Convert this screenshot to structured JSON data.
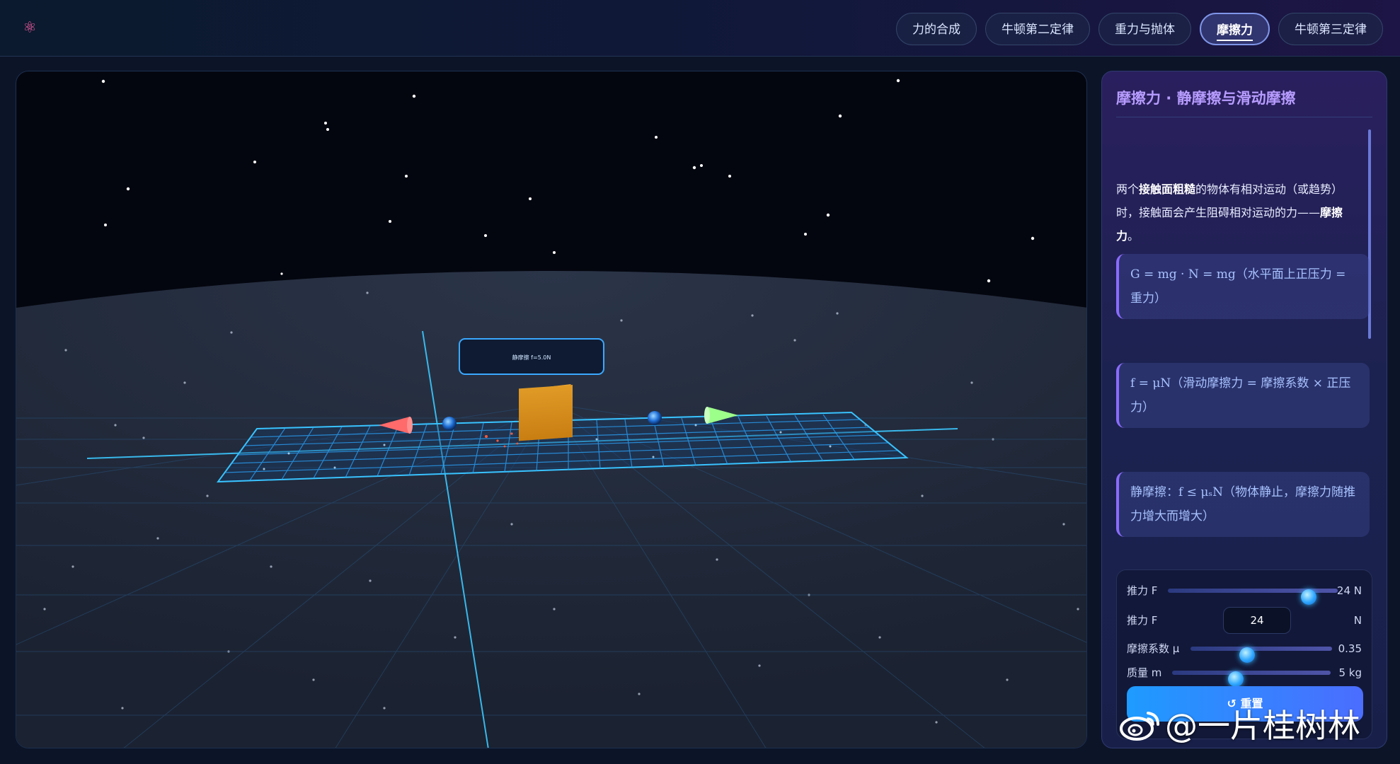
{
  "header": {
    "app_title": "",
    "tabs": [
      {
        "label": "力的合成",
        "active": false
      },
      {
        "label": "牛顿第二定律",
        "active": false
      },
      {
        "label": "重力与抛体",
        "active": false
      },
      {
        "label": "摩擦力",
        "active": true
      },
      {
        "label": "牛顿第三定律",
        "active": false
      }
    ]
  },
  "scene": {
    "label_text": "静摩擦 f=5.0N",
    "box_color": "#d98c1e",
    "push_arrow_color": "#9cff8a",
    "friction_arrow_color": "#ff6a6a",
    "grid_color": "#2ab4ff"
  },
  "panel": {
    "title": "摩擦力 · 静摩擦与滑动摩擦",
    "intro_1": "两个",
    "intro_bold_1": "接触面粗糙",
    "intro_2": "的物体有相对运动（或趋势）时，接触面会产生阻碍相对运动的力——",
    "intro_bold_2": "摩擦力",
    "intro_3": "。",
    "formulas": [
      "G = mg · N = mg（水平面上正压力 = 重力）",
      "f = μN（滑动摩擦力 = 摩擦系数 × 正压力）",
      "静摩擦：f ≤ μₛN（物体静止，摩擦力随推力增大而增大）"
    ]
  },
  "controls": {
    "push_label": "推力 F",
    "push_display": "24 N",
    "push_fraction": 0.83,
    "push_input_label": "推力 F",
    "push_input_value": "24",
    "push_input_unit": "N",
    "mu_label": "摩擦系数 μ",
    "mu_display": "0.35",
    "mu_fraction": 0.4,
    "mass_label": "质量 m",
    "mass_display": "5 kg",
    "mass_fraction": 0.4,
    "reset_label": "↺ 重置"
  },
  "watermark": {
    "text": "@一片桂树林"
  }
}
